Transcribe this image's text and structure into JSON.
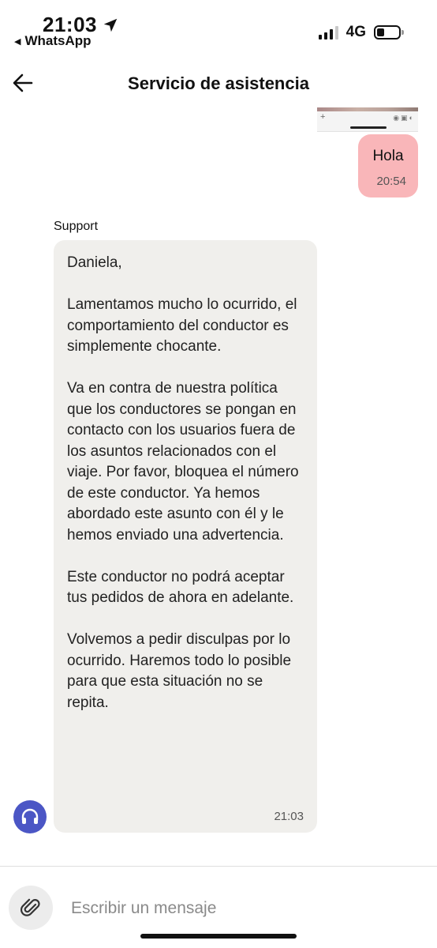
{
  "status_bar": {
    "time": "21:03",
    "back_app": "WhatsApp",
    "network": "4G",
    "icons": [
      "location-arrow-icon",
      "signal-icon",
      "battery-icon"
    ]
  },
  "header": {
    "title": "Servicio de asistencia",
    "back_icon": "back-arrow-icon"
  },
  "messages": {
    "outgoing": {
      "text": "Hola",
      "time": "20:54",
      "color": "#f9b6b9"
    },
    "incoming": {
      "sender": "Support",
      "paragraphs": [
        "Daniela,",
        "Lamentamos mucho lo ocurrido, el comportamiento del conductor es simplemente chocante.",
        "Va en contra de nuestra política que los conductores se pongan en contacto con los usuarios fuera de los asuntos relacionados con el viaje. Por favor, bloquea el número de este conductor. Ya hemos abordado este asunto con él y le hemos enviado una advertencia.",
        "Este conductor no podrá aceptar tus pedidos de ahora en adelante.",
        "Volvemos a pedir disculpas por lo ocurrido. Haremos todo lo posible para que esta situación no se repita."
      ],
      "time": "21:03",
      "bubble_color": "#f0efec",
      "avatar_icon": "headphones-icon",
      "avatar_color": "#4b56c5"
    }
  },
  "composer": {
    "placeholder": "Escribir un mensaje",
    "attach_icon": "paperclip-icon"
  }
}
